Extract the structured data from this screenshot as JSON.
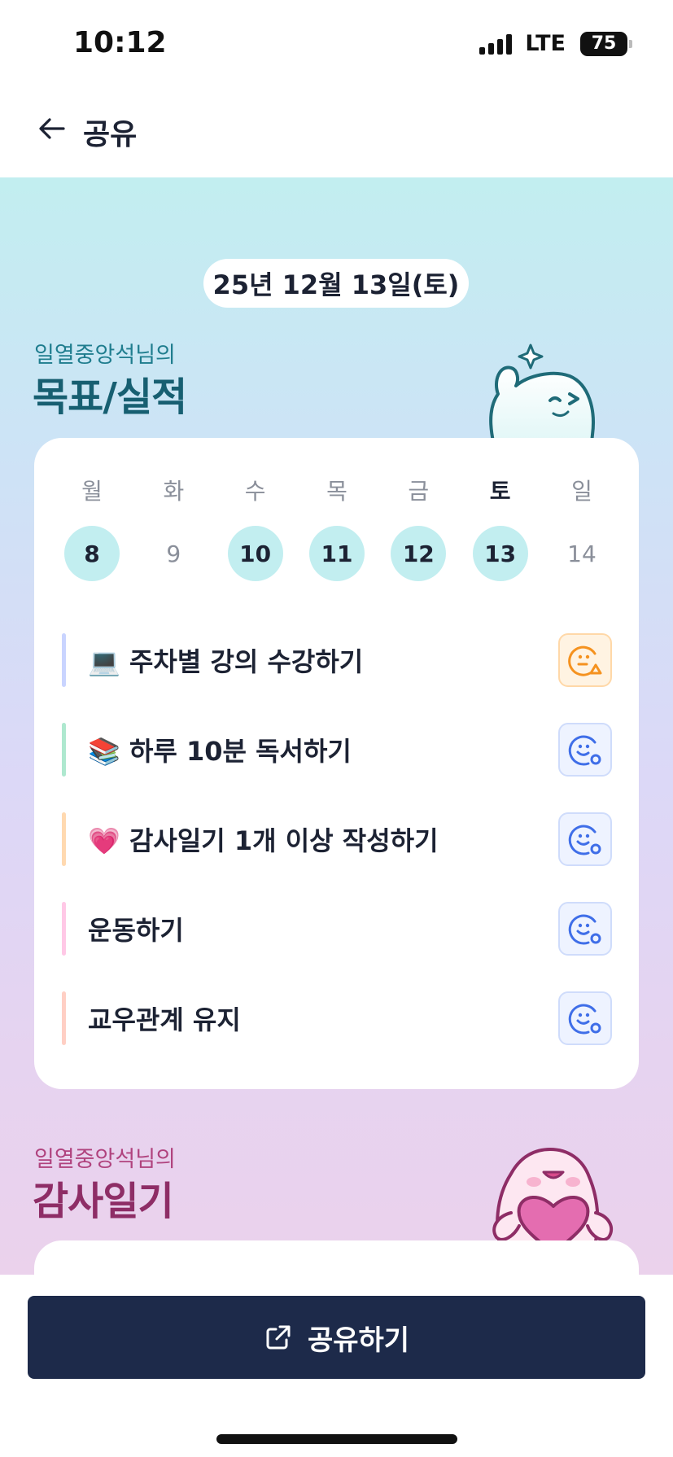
{
  "status_bar": {
    "time": "10:12",
    "network": "LTE",
    "battery": "75"
  },
  "nav": {
    "title": "공유",
    "back_icon": "arrow-left-icon"
  },
  "date": "25년 12월 13일(토)",
  "goals_section": {
    "owner": "일열중앙석님의",
    "heading": "목표/실적"
  },
  "week": {
    "days": [
      {
        "weekday": "월",
        "date": "8",
        "completed": true,
        "today": false
      },
      {
        "weekday": "화",
        "date": "9",
        "completed": false,
        "today": false
      },
      {
        "weekday": "수",
        "date": "10",
        "completed": true,
        "today": false
      },
      {
        "weekday": "목",
        "date": "11",
        "completed": true,
        "today": false
      },
      {
        "weekday": "금",
        "date": "12",
        "completed": true,
        "today": false
      },
      {
        "weekday": "토",
        "date": "13",
        "completed": true,
        "today": true
      },
      {
        "weekday": "일",
        "date": "14",
        "completed": false,
        "today": false
      }
    ]
  },
  "goals": [
    {
      "text": "💻 주차별 강의 수강하기",
      "status": "partial",
      "color": "#c9d4ff"
    },
    {
      "text": "📚 하루 10분 독서하기",
      "status": "complete",
      "color": "#aee8cf"
    },
    {
      "text": "💗 감사일기 1개 이상 작성하기",
      "status": "complete",
      "color": "#ffd9b0"
    },
    {
      "text": "운동하기",
      "status": "complete",
      "color": "#ffc8e6"
    },
    {
      "text": "교우관계 유지",
      "status": "complete",
      "color": "#ffcfc4"
    }
  ],
  "gratitude_section": {
    "owner": "일열중앙석님의",
    "heading": "감사일기"
  },
  "share_button": {
    "label": "공유하기",
    "icon": "external-link-icon"
  },
  "colors": {
    "accent_navy": "#1d2a4a",
    "done_circle": "#c2eef0",
    "partial": "#f5921f",
    "complete": "#3f6ee8"
  }
}
